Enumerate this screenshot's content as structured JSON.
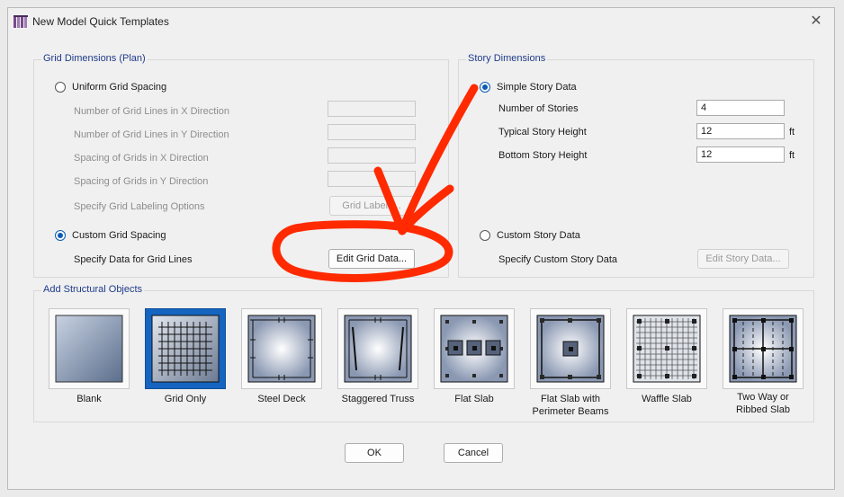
{
  "window": {
    "title": "New Model Quick Templates",
    "icon": "etabs-app-icon",
    "close_glyph": "✕"
  },
  "grid": {
    "group_title": "Grid Dimensions (Plan)",
    "uniform_label": "Uniform Grid Spacing",
    "uniform_selected": false,
    "fields": [
      "Number of Grid Lines in X Direction",
      "Number of Grid Lines in Y Direction",
      "Spacing of Grids in X Direction",
      "Spacing of Grids in Y Direction"
    ],
    "labeling_label": "Specify Grid Labeling Options",
    "labels_button": "Grid Labels...",
    "custom_label": "Custom Grid Spacing",
    "custom_selected": true,
    "specify_label": "Specify Data for Grid Lines",
    "edit_button": "Edit Grid Data..."
  },
  "story": {
    "group_title": "Story Dimensions",
    "simple_label": "Simple Story Data",
    "simple_selected": true,
    "num_stories_label": "Number of Stories",
    "num_stories": "4",
    "typical_height_label": "Typical Story Height",
    "typical_height": "12",
    "typical_unit": "ft",
    "bottom_height_label": "Bottom Story Height",
    "bottom_height": "12",
    "bottom_unit": "ft",
    "custom_label": "Custom Story Data",
    "custom_selected": false,
    "specify_label": "Specify Custom Story Data",
    "edit_button": "Edit Story Data..."
  },
  "structural": {
    "group_title": "Add Structural Objects",
    "selected": "Grid Only",
    "templates": [
      {
        "label1": "Blank",
        "label2": ""
      },
      {
        "label1": "Grid Only",
        "label2": ""
      },
      {
        "label1": "Steel Deck",
        "label2": ""
      },
      {
        "label1": "Staggered Truss",
        "label2": ""
      },
      {
        "label1": "Flat Slab",
        "label2": ""
      },
      {
        "label1": "Flat Slab with",
        "label2": "Perimeter Beams"
      },
      {
        "label1": "Waffle Slab",
        "label2": ""
      },
      {
        "label1": "Two Way or",
        "label2": "Ribbed Slab"
      }
    ]
  },
  "footer": {
    "ok": "OK",
    "cancel": "Cancel"
  },
  "colors": {
    "accent": "#0a5bb5",
    "selected_tile": "#1565c0",
    "group_title": "#1f3b8a",
    "annotation": "#ff2a00"
  }
}
